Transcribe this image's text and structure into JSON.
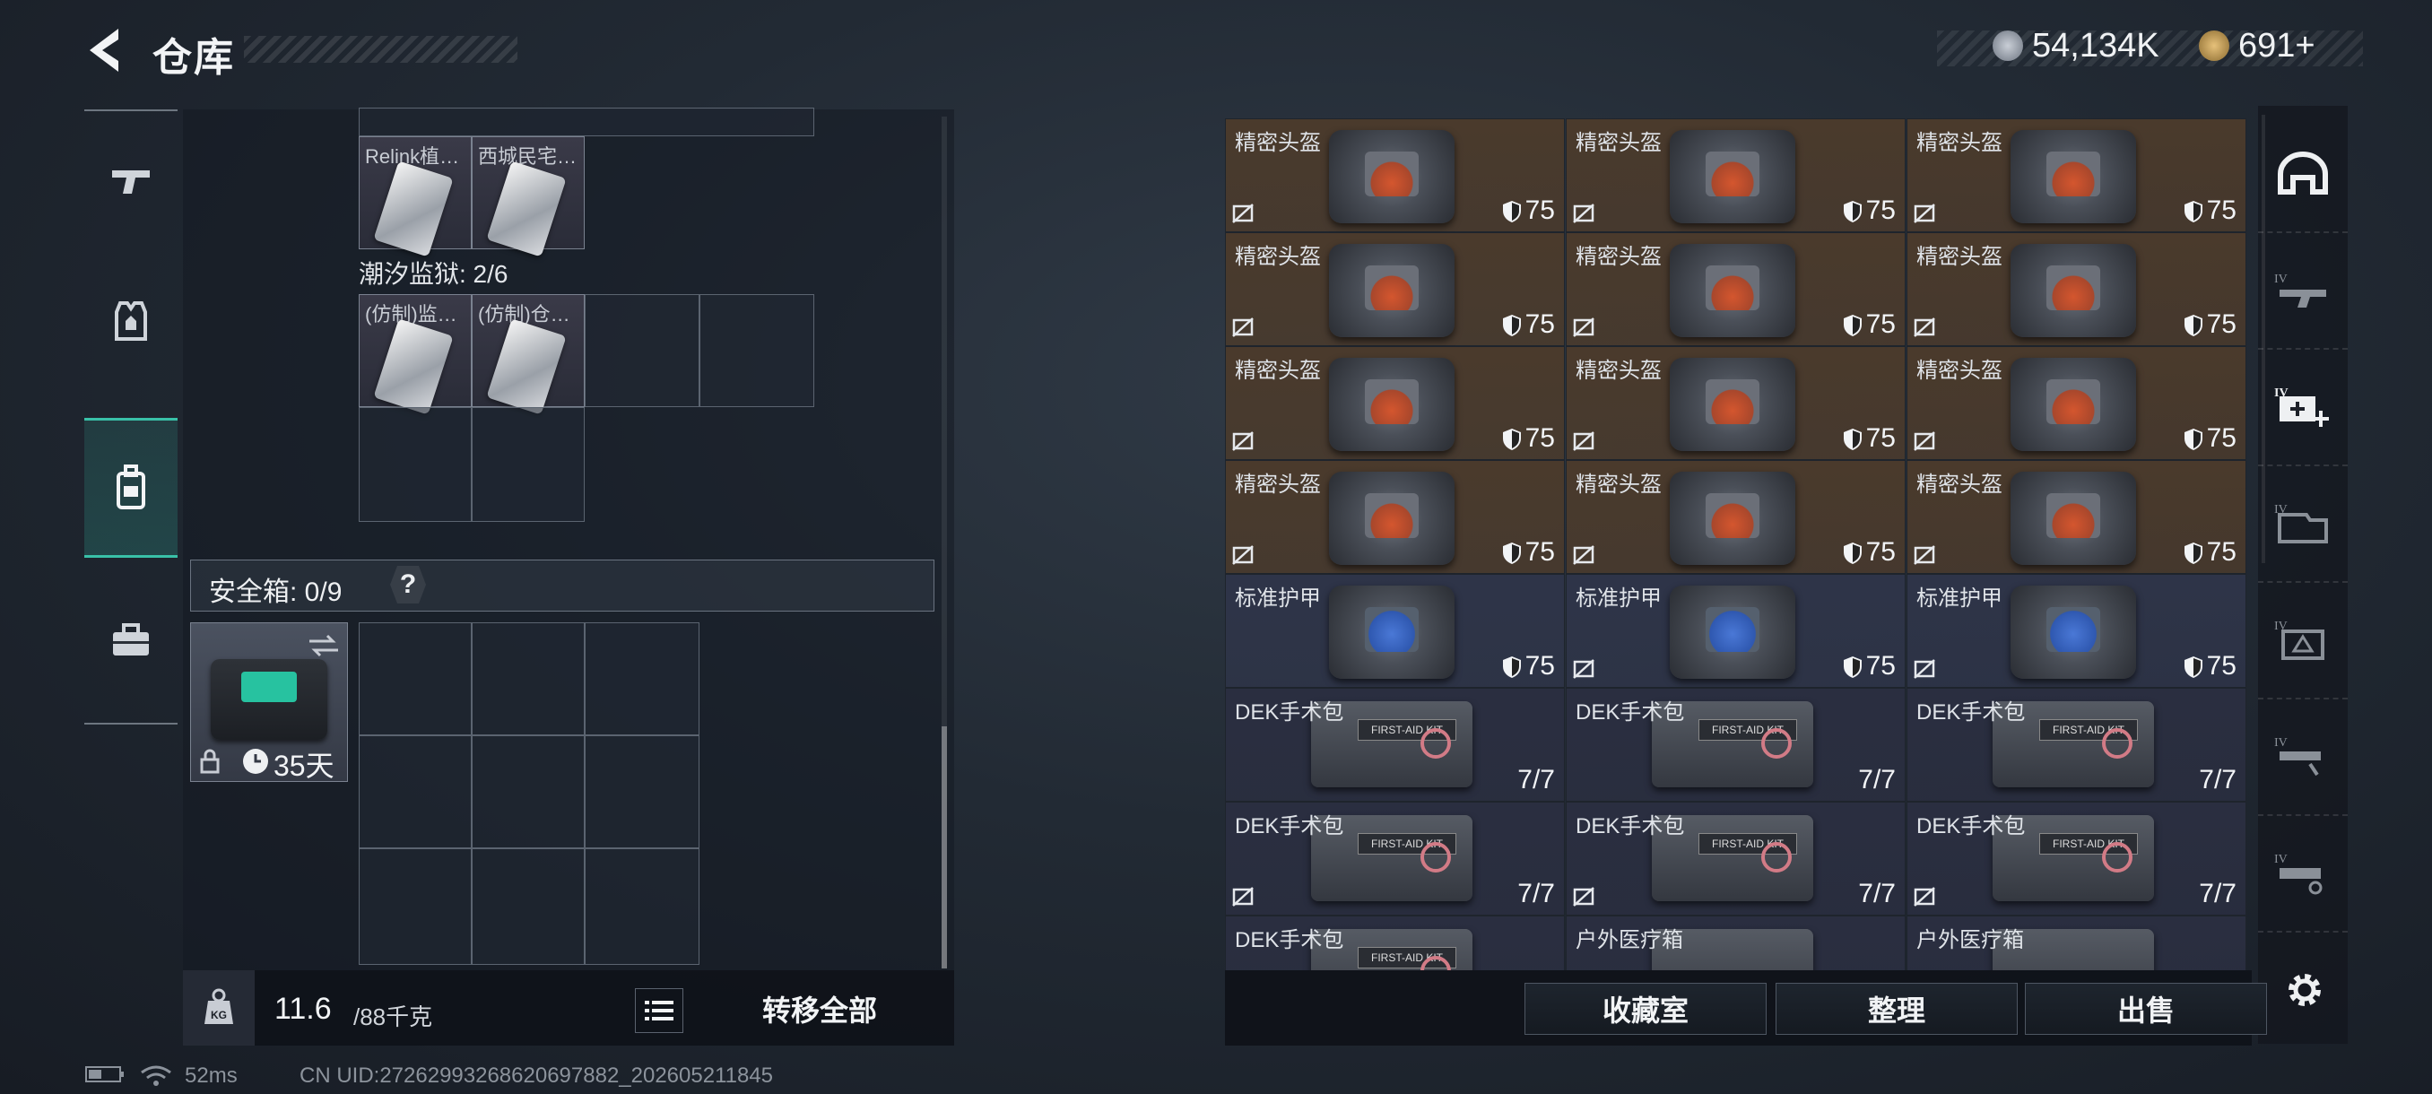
{
  "header": {
    "title": "仓库",
    "currency_a": "54,134K",
    "currency_b": "691+"
  },
  "colors": {
    "accent": "#39c1a8",
    "helmet_bg": "#4a3a2c",
    "armor_bg": "#2e3448",
    "med_bg": "#2a2e40"
  },
  "left_nav": {
    "items": [
      {
        "icon": "gun-icon"
      },
      {
        "icon": "armor-vest-icon"
      },
      {
        "icon": "backpack-icon",
        "active": true
      },
      {
        "icon": "toolbox-icon"
      }
    ]
  },
  "left_panel": {
    "items_top": [
      {
        "label": "Relink植…"
      },
      {
        "label": "西城民宅…"
      }
    ],
    "section1_label": "潮汐监狱: 2/6",
    "items_mid": [
      {
        "label": "(仿制)监…"
      },
      {
        "label": "(仿制)仓…"
      }
    ],
    "safe_box_label": "安全箱: 0/9",
    "safe_help": "?",
    "safe_item_time": "35天",
    "weight_value": "11.6",
    "weight_total": "/88千克",
    "transfer_all": "转移全部"
  },
  "status_bar": {
    "ping": "52ms",
    "uid": "CN UID:2726299326862069788​2_202605211845"
  },
  "right_panel": {
    "rows": [
      [
        {
          "label": "精密头盔",
          "value": "75",
          "type": "helmet"
        },
        {
          "label": "精密头盔",
          "value": "75",
          "type": "helmet"
        },
        {
          "label": "精密头盔",
          "value": "75",
          "type": "helmet"
        }
      ],
      [
        {
          "label": "精密头盔",
          "value": "75",
          "type": "helmet"
        },
        {
          "label": "精密头盔",
          "value": "75",
          "type": "helmet"
        },
        {
          "label": "精密头盔",
          "value": "75",
          "type": "helmet"
        }
      ],
      [
        {
          "label": "精密头盔",
          "value": "75",
          "type": "helmet"
        },
        {
          "label": "精密头盔",
          "value": "75",
          "type": "helmet"
        },
        {
          "label": "精密头盔",
          "value": "75",
          "type": "helmet"
        }
      ],
      [
        {
          "label": "精密头盔",
          "value": "75",
          "type": "helmet"
        },
        {
          "label": "精密头盔",
          "value": "75",
          "type": "helmet"
        },
        {
          "label": "精密头盔",
          "value": "75",
          "type": "helmet"
        }
      ],
      [
        {
          "label": "标准护甲",
          "value": "75",
          "type": "armor"
        },
        {
          "label": "标准护甲",
          "value": "75",
          "type": "armor"
        },
        {
          "label": "标准护甲",
          "value": "75",
          "type": "armor"
        }
      ],
      [
        {
          "label": "DEK手术包",
          "value": "7/7",
          "type": "med"
        },
        {
          "label": "DEK手术包",
          "value": "7/7",
          "type": "med"
        },
        {
          "label": "DEK手术包",
          "value": "7/7",
          "type": "med"
        }
      ],
      [
        {
          "label": "DEK手术包",
          "value": "7/7",
          "type": "med"
        },
        {
          "label": "DEK手术包",
          "value": "7/7",
          "type": "med"
        },
        {
          "label": "DEK手术包",
          "value": "7/7",
          "type": "med"
        }
      ],
      [
        {
          "label": "DEK手术包",
          "value": "",
          "type": "med"
        },
        {
          "label": "户外医疗箱",
          "value": "",
          "type": "medbox"
        },
        {
          "label": "户外医疗箱",
          "value": "",
          "type": "medbox"
        }
      ]
    ],
    "med_strip": "FIRST-AID KIT",
    "buttons": {
      "collection": "收藏室",
      "organize": "整理",
      "sell": "出售"
    }
  }
}
